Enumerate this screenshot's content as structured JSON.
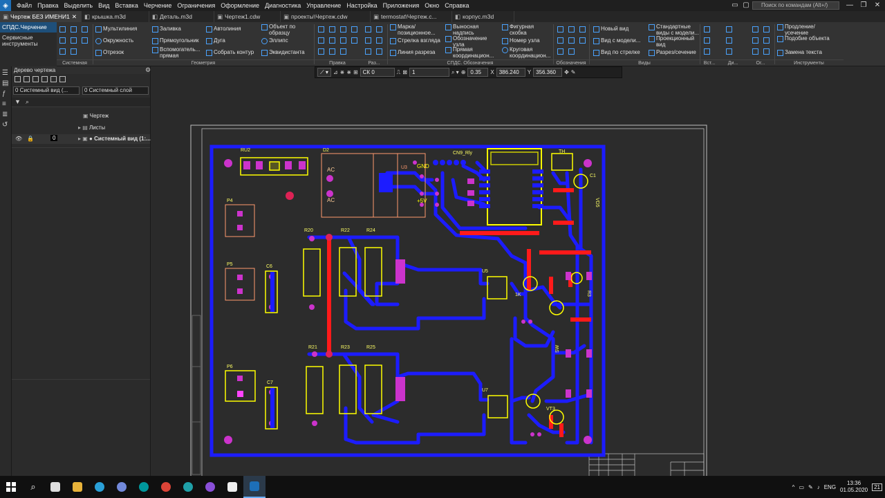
{
  "menu": {
    "items": [
      "Файл",
      "Правка",
      "Выделить",
      "Вид",
      "Вставка",
      "Черчение",
      "Ограничения",
      "Оформление",
      "Диагностика",
      "Управление",
      "Настройка",
      "Приложения",
      "Окно",
      "Справка"
    ],
    "search_placeholder": "Поиск по командам (Alt+/)"
  },
  "tabs": [
    {
      "label": "Чертеж БЕЗ ИМЕНИ1",
      "active": true
    },
    {
      "label": "крышка.m3d"
    },
    {
      "label": "Деталь.m3d"
    },
    {
      "label": "Чертеж1.cdw"
    },
    {
      "label": "проекты\\Чертеж.cdw"
    },
    {
      "label": "termostat\\Чертеж.c..."
    },
    {
      "label": "корпус.m3d"
    }
  ],
  "ribbon": {
    "left_tabs": [
      "СПДС.Черчение",
      "Сервисные инструменты"
    ],
    "geometry": [
      "Мультилиния",
      "Окружность",
      "Отрезок",
      "Заливка",
      "Прямоугольник",
      "Вспомогатель... прямая",
      "Автолиния",
      "Дуга",
      "Собрать контур",
      "Объект по образцу",
      "Эллипс",
      "Эквидистанта"
    ],
    "marks": [
      "Марка/ позиционное...",
      "Стрелка взгляда",
      "Линия разреза",
      "Выносная надпись",
      "Обозначение узла",
      "Прямая координацион...",
      "Фигурная скобка",
      "Номер узла",
      "Круговая координацион..."
    ],
    "views": [
      "Новый вид",
      "Вид с модели...",
      "Вид по стрелке",
      "Стандартные виды с модели...",
      "Проекционный вид",
      "Разрез/сечение"
    ],
    "tools": [
      "Продление/ усечение",
      "Подобие объекта",
      "Замена текста"
    ],
    "sections": {
      "system": "Системная",
      "geometry": "Геометрия",
      "edit": "Правка",
      "sizes": "Раз...",
      "spds": "СПДС. Обозначения",
      "marks_label": "Обозначения",
      "views": "Виды",
      "insert": "Вст...",
      "dim": "Ди...",
      "og": "Ог...",
      "tools": "Инструменты"
    }
  },
  "tree": {
    "title": "Дерево чертежа",
    "view_combo": "0  Системный вид (...",
    "layer_combo": "0  Системный слой",
    "rows": [
      "Чертеж",
      "Листы",
      "● Системный вид (1:..."
    ],
    "layer_num": "0"
  },
  "view_toolbar": {
    "sk": "СК 0",
    "scale_num": "1",
    "zoom": "0.35",
    "x_label": "X",
    "x_value": "386.240",
    "y_label": "Y",
    "y_value": "356.360"
  },
  "pcb": {
    "labels": [
      "RU2",
      "D2",
      "CN9_Rly",
      "U3",
      "AC",
      "AC",
      "GND",
      "+5V",
      "R20",
      "R22",
      "R24",
      "P4",
      "P5",
      "C6",
      "P6",
      "C7",
      "R21",
      "R23",
      "R25",
      "U5",
      "U7",
      "TH",
      "C1",
      "VD5",
      "VT3",
      "R3",
      "SW",
      "1K"
    ]
  },
  "taskbar": {
    "lang": "ENG",
    "time": "13:36",
    "date": "01.05.2020",
    "badge": "21"
  }
}
